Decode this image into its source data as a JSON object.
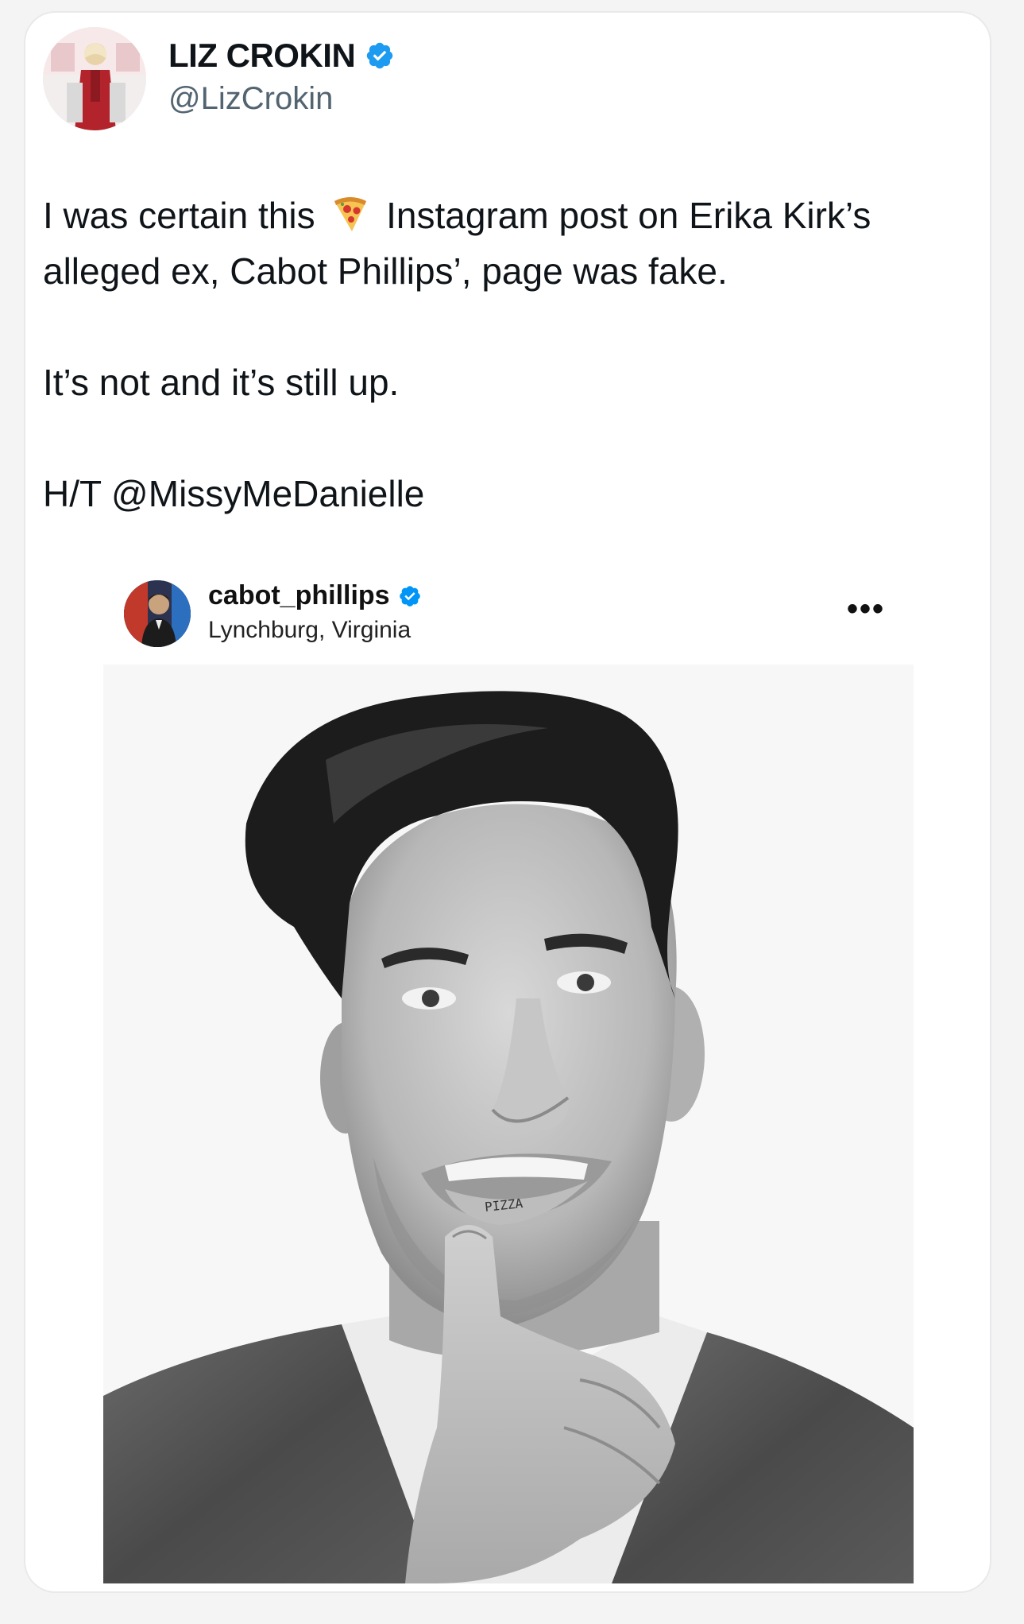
{
  "tweet": {
    "display_name": "LIZ CROKIN",
    "handle": "@LizCrokin",
    "verified_icon": "verified-badge-icon",
    "text_line1_before": "I was certain this",
    "inline_emoji": "pizza-emoji-icon",
    "text_line1_after": "Instagram post on Erika Kirk’s",
    "text_line2": "alleged ex, Cabot Phillips’, page was fake.",
    "text_paragraph2": "It’s not and it’s still up.",
    "text_paragraph3": "H/T @MissyMeDanielle"
  },
  "embedded_post": {
    "username": "cabot_phillips",
    "location": "Lynchburg, Virginia",
    "verified_icon": "verified-badge-icon",
    "more_label": "•••",
    "photo_lip_text": "PIZZA"
  },
  "colors": {
    "verified_blue": "#1d9bf0",
    "ig_verified_blue": "#0095f6",
    "handle_gray": "#536471",
    "text_dark": "#0f1419"
  }
}
